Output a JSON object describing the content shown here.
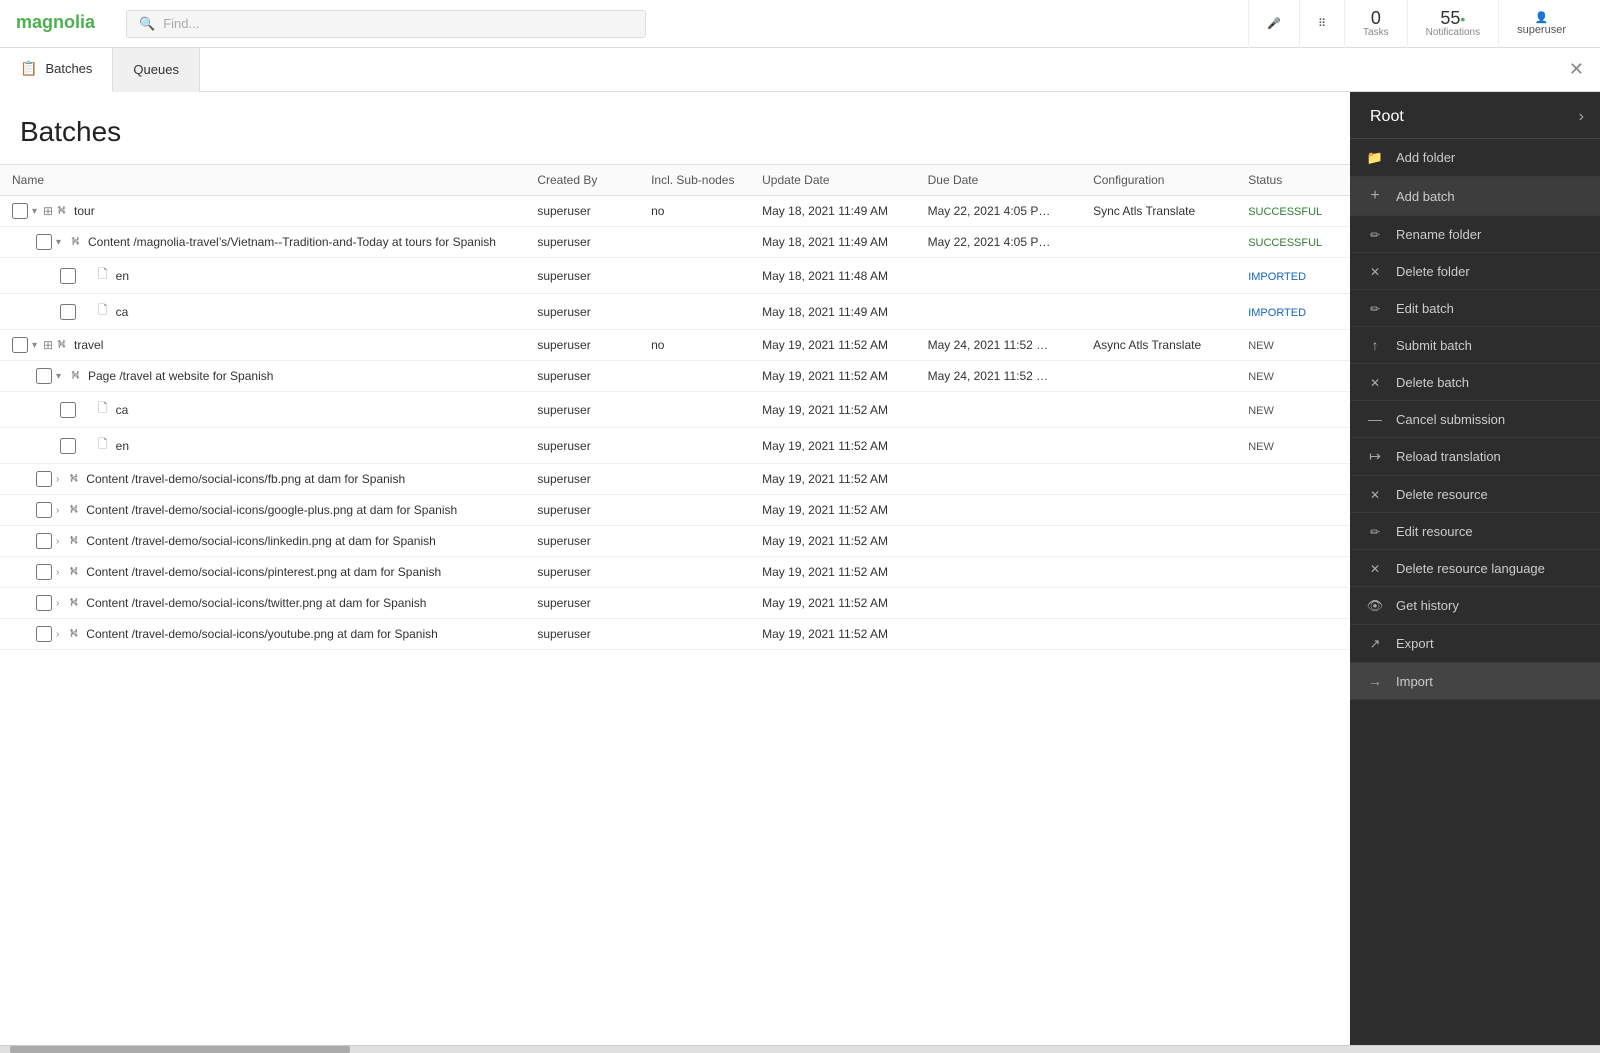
{
  "app": {
    "title": "Magnolia CMS"
  },
  "topnav": {
    "search_placeholder": "Find...",
    "tasks_label": "Tasks",
    "tasks_count": "0",
    "notifications_label": "Notifications",
    "notifications_count": "55",
    "user_label": "superuser"
  },
  "tabs": [
    {
      "id": "batches",
      "label": "Batches",
      "active": true
    },
    {
      "id": "queues",
      "label": "Queues",
      "active": false
    }
  ],
  "page": {
    "title": "Batches"
  },
  "table": {
    "columns": [
      "Name",
      "Created By",
      "Incl. Sub-nodes",
      "Update Date",
      "Due Date",
      "Configuration",
      "Status"
    ],
    "rows": [
      {
        "id": 1,
        "indent": 0,
        "expandable": true,
        "expanded": true,
        "type": "folder",
        "name": "tour",
        "created_by": "superuser",
        "incl_subnodes": "no",
        "update_date": "May 18, 2021 11:49 AM",
        "due_date": "May 22, 2021 4:05 P…",
        "configuration": "Sync Atls Translate",
        "status": "SUCCESSFUL",
        "status_class": "status-success"
      },
      {
        "id": 2,
        "indent": 1,
        "expandable": true,
        "expanded": true,
        "type": "tree",
        "name": "Content /magnolia-travel’s/Vietnam--Tradition-and-Today at tours for Spanish",
        "created_by": "superuser",
        "incl_subnodes": "",
        "update_date": "May 18, 2021 11:49 AM",
        "due_date": "May 22, 2021 4:05 P…",
        "configuration": "",
        "status": "SUCCESSFUL",
        "status_class": "status-success"
      },
      {
        "id": 3,
        "indent": 2,
        "expandable": false,
        "type": "page",
        "name": "en",
        "created_by": "superuser",
        "incl_subnodes": "",
        "update_date": "May 18, 2021 11:48 AM",
        "due_date": "",
        "configuration": "",
        "status": "IMPORTED",
        "status_class": "status-imported"
      },
      {
        "id": 4,
        "indent": 2,
        "expandable": false,
        "type": "page",
        "name": "ca",
        "created_by": "superuser",
        "incl_subnodes": "",
        "update_date": "May 18, 2021 11:49 AM",
        "due_date": "",
        "configuration": "",
        "status": "IMPORTED",
        "status_class": "status-imported"
      },
      {
        "id": 5,
        "indent": 0,
        "expandable": true,
        "expanded": true,
        "type": "folder",
        "name": "travel",
        "created_by": "superuser",
        "incl_subnodes": "no",
        "update_date": "May 19, 2021 11:52 AM",
        "due_date": "May 24, 2021 11:52 …",
        "configuration": "Async Atls Translate",
        "status": "NEW",
        "status_class": "status-new"
      },
      {
        "id": 6,
        "indent": 1,
        "expandable": true,
        "expanded": true,
        "type": "tree",
        "name": "Page /travel at website for Spanish",
        "created_by": "superuser",
        "incl_subnodes": "",
        "update_date": "May 19, 2021 11:52 AM",
        "due_date": "May 24, 2021 11:52 …",
        "configuration": "",
        "status": "NEW",
        "status_class": "status-new"
      },
      {
        "id": 7,
        "indent": 2,
        "expandable": false,
        "type": "page",
        "name": "ca",
        "created_by": "superuser",
        "incl_subnodes": "",
        "update_date": "May 19, 2021 11:52 AM",
        "due_date": "",
        "configuration": "",
        "status": "NEW",
        "status_class": "status-new"
      },
      {
        "id": 8,
        "indent": 2,
        "expandable": false,
        "type": "page",
        "name": "en",
        "created_by": "superuser",
        "incl_subnodes": "",
        "update_date": "May 19, 2021 11:52 AM",
        "due_date": "",
        "configuration": "",
        "status": "NEW",
        "status_class": "status-new"
      },
      {
        "id": 9,
        "indent": 1,
        "expandable": true,
        "expanded": false,
        "type": "tree",
        "name": "Content /travel-demo/social-icons/fb.png at dam for Spanish",
        "created_by": "superuser",
        "incl_subnodes": "",
        "update_date": "May 19, 2021 11:52 AM",
        "due_date": "",
        "configuration": "",
        "status": "",
        "status_class": ""
      },
      {
        "id": 10,
        "indent": 1,
        "expandable": true,
        "expanded": false,
        "type": "tree",
        "name": "Content /travel-demo/social-icons/google-plus.png at dam for Spanish",
        "created_by": "superuser",
        "incl_subnodes": "",
        "update_date": "May 19, 2021 11:52 AM",
        "due_date": "",
        "configuration": "",
        "status": "",
        "status_class": ""
      },
      {
        "id": 11,
        "indent": 1,
        "expandable": true,
        "expanded": false,
        "type": "tree",
        "name": "Content /travel-demo/social-icons/linkedin.png at dam for Spanish",
        "created_by": "superuser",
        "incl_subnodes": "",
        "update_date": "May 19, 2021 11:52 AM",
        "due_date": "",
        "configuration": "",
        "status": "",
        "status_class": ""
      },
      {
        "id": 12,
        "indent": 1,
        "expandable": true,
        "expanded": false,
        "type": "tree",
        "name": "Content /travel-demo/social-icons/pinterest.png at dam for Spanish",
        "created_by": "superuser",
        "incl_subnodes": "",
        "update_date": "May 19, 2021 11:52 AM",
        "due_date": "",
        "configuration": "",
        "status": "",
        "status_class": ""
      },
      {
        "id": 13,
        "indent": 1,
        "expandable": true,
        "expanded": false,
        "type": "tree",
        "name": "Content /travel-demo/social-icons/twitter.png at dam for Spanish",
        "created_by": "superuser",
        "incl_subnodes": "",
        "update_date": "May 19, 2021 11:52 AM",
        "due_date": "",
        "configuration": "",
        "status": "",
        "status_class": ""
      },
      {
        "id": 14,
        "indent": 1,
        "expandable": true,
        "expanded": false,
        "type": "tree",
        "name": "Content /travel-demo/social-icons/youtube.png at dam for Spanish",
        "created_by": "superuser",
        "incl_subnodes": "",
        "update_date": "May 19, 2021 11:52 AM",
        "due_date": "",
        "configuration": "",
        "status": "",
        "status_class": ""
      }
    ]
  },
  "sidebar": {
    "title": "Root",
    "items": [
      {
        "id": "add-folder",
        "label": "Add folder",
        "icon": "📁",
        "icon_name": "folder-icon",
        "enabled": true
      },
      {
        "id": "add-batch",
        "label": "Add batch",
        "icon": "+",
        "icon_name": "plus-icon",
        "enabled": true,
        "highlighted": true
      },
      {
        "id": "rename-folder",
        "label": "Rename folder",
        "icon": "✏️",
        "icon_name": "pencil-icon",
        "enabled": true
      },
      {
        "id": "delete-folder",
        "label": "Delete folder",
        "icon": "✕",
        "icon_name": "delete-folder-icon",
        "enabled": true
      },
      {
        "id": "edit-batch",
        "label": "Edit batch",
        "icon": "✏️",
        "icon_name": "edit-batch-icon",
        "enabled": true
      },
      {
        "id": "submit-batch",
        "label": "Submit batch",
        "icon": "↑",
        "icon_name": "submit-icon",
        "enabled": true
      },
      {
        "id": "delete-batch",
        "label": "Delete batch",
        "icon": "✕",
        "icon_name": "delete-batch-icon",
        "enabled": true
      },
      {
        "id": "cancel-submission",
        "label": "Cancel submission",
        "icon": "—",
        "icon_name": "cancel-icon",
        "enabled": true
      },
      {
        "id": "reload-translation",
        "label": "Reload translation",
        "icon": "↦",
        "icon_name": "reload-icon",
        "enabled": true
      },
      {
        "id": "delete-resource",
        "label": "Delete resource",
        "icon": "✕",
        "icon_name": "delete-resource-icon",
        "enabled": true
      },
      {
        "id": "edit-resource",
        "label": "Edit resource",
        "icon": "✏️",
        "icon_name": "edit-resource-icon",
        "enabled": true
      },
      {
        "id": "delete-resource-language",
        "label": "Delete resource language",
        "icon": "✕",
        "icon_name": "delete-resource-lang-icon",
        "enabled": true
      },
      {
        "id": "get-history",
        "label": "Get history",
        "icon": "👁",
        "icon_name": "history-icon",
        "enabled": true
      },
      {
        "id": "export",
        "label": "Export",
        "icon": "↗",
        "icon_name": "export-icon",
        "enabled": true
      },
      {
        "id": "import",
        "label": "Import",
        "icon": "→",
        "icon_name": "import-icon",
        "enabled": true,
        "active": true
      }
    ]
  }
}
